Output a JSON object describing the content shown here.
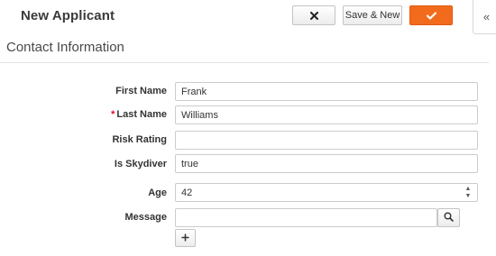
{
  "header": {
    "title": "New Applicant",
    "cancel_icon": "close-icon",
    "save_new_label": "Save & New",
    "save_icon": "checkmark-icon",
    "collapse_label": "«"
  },
  "section": {
    "title": "Contact Information"
  },
  "form": {
    "first_name": {
      "label": "First Name",
      "value": "Frank"
    },
    "last_name": {
      "label": "Last Name",
      "value": "Williams",
      "required_marker": "*"
    },
    "risk_rating": {
      "label": "Risk Rating",
      "value": ""
    },
    "is_skydiver": {
      "label": "Is Skydiver",
      "value": "true"
    },
    "age": {
      "label": "Age",
      "value": "42"
    },
    "message": {
      "label": "Message",
      "value": "",
      "lookup_icon": "search-icon",
      "add_icon": "plus-icon"
    }
  },
  "colors": {
    "accent": "#f26b1d",
    "required": "#e4062b"
  }
}
